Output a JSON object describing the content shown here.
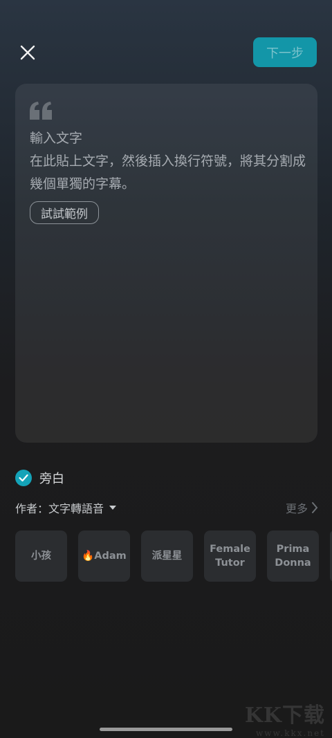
{
  "header": {
    "close_icon": "close-icon",
    "next_label": "下一步",
    "next_color": "#1396a8"
  },
  "editor": {
    "title": "輸入文字",
    "hint": "在此貼上文字，然後插入換行符號，將其分割成幾個單獨的字幕。",
    "example_button": "試試範例"
  },
  "narration": {
    "checked": true,
    "label": "旁白",
    "check_color": "#14a3b8"
  },
  "author": {
    "label": "作者：文字轉語音",
    "more_label": "更多"
  },
  "voices": [
    {
      "label": "小孩"
    },
    {
      "label": "🔥Adam"
    },
    {
      "label": "派星星"
    },
    {
      "label": "Female Tutor"
    },
    {
      "label": "Prima Donna"
    }
  ],
  "watermark": {
    "logo": "KK下载",
    "url": "www.kkx.net"
  }
}
